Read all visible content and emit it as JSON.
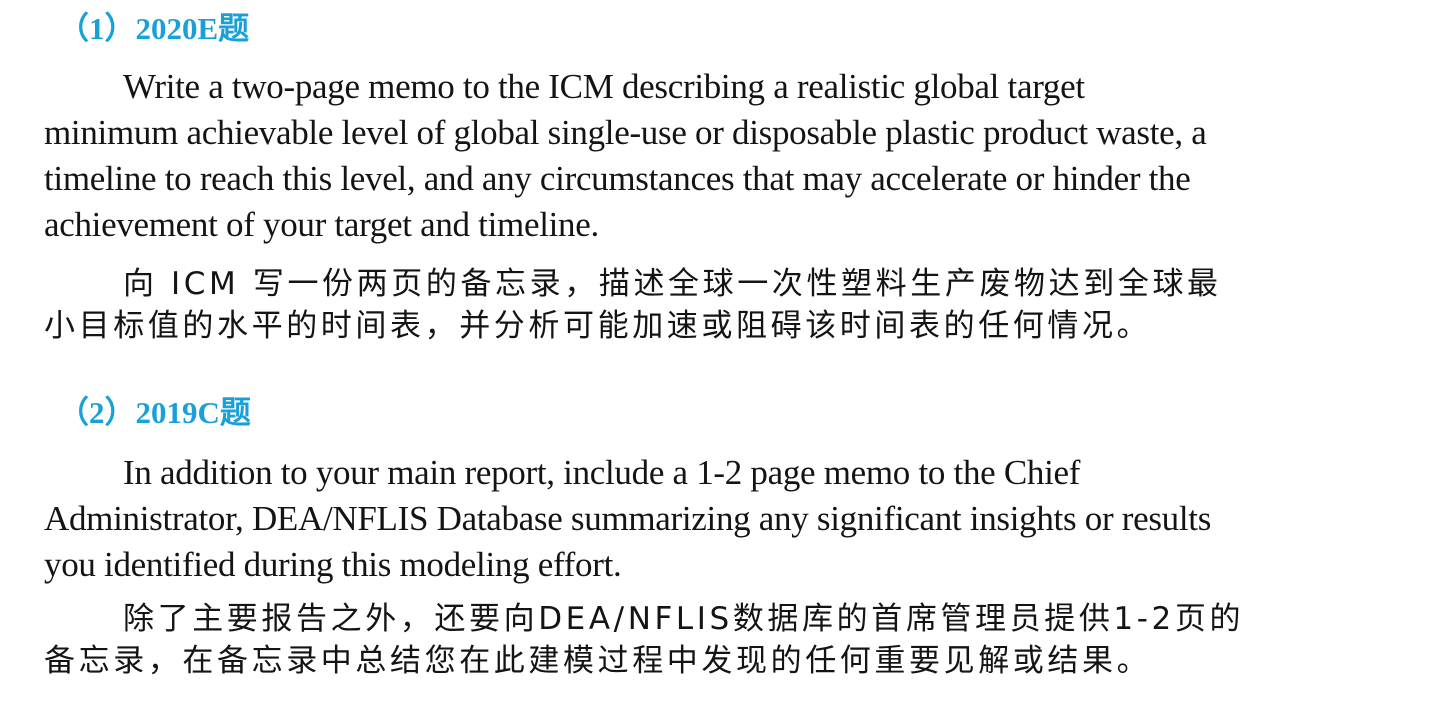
{
  "section1": {
    "heading": "（1）2020E题",
    "english_lines": [
      "Write a two-page memo to the ICM describing a realistic global target",
      "minimum achievable level of global single-use or disposable plastic product waste, a",
      "timeline to reach this level, and any circumstances that may accelerate or hinder the",
      "achievement of your target and timeline."
    ],
    "chinese_lines": [
      "向 ICM 写一份两页的备忘录，描述全球一次性塑料生产废物达到全球最",
      "小目标值的水平的时间表，并分析可能加速或阻碍该时间表的任何情况。"
    ]
  },
  "section2": {
    "heading": "（2）2019C题",
    "english_lines": [
      "In addition to your main report, include a 1-2 page memo to the Chief",
      "Administrator, DEA/NFLIS Database summarizing any significant insights or results",
      "you identified during this modeling effort."
    ],
    "chinese_lines": [
      "除了主要报告之外，还要向DEA/NFLIS数据库的首席管理员提供1-2页的",
      "备忘录，在备忘录中总结您在此建模过程中发现的任何重要见解或结果。"
    ]
  },
  "colors": {
    "heading": "#1aa0d8",
    "text": "#141414",
    "background": "#ffffff"
  }
}
